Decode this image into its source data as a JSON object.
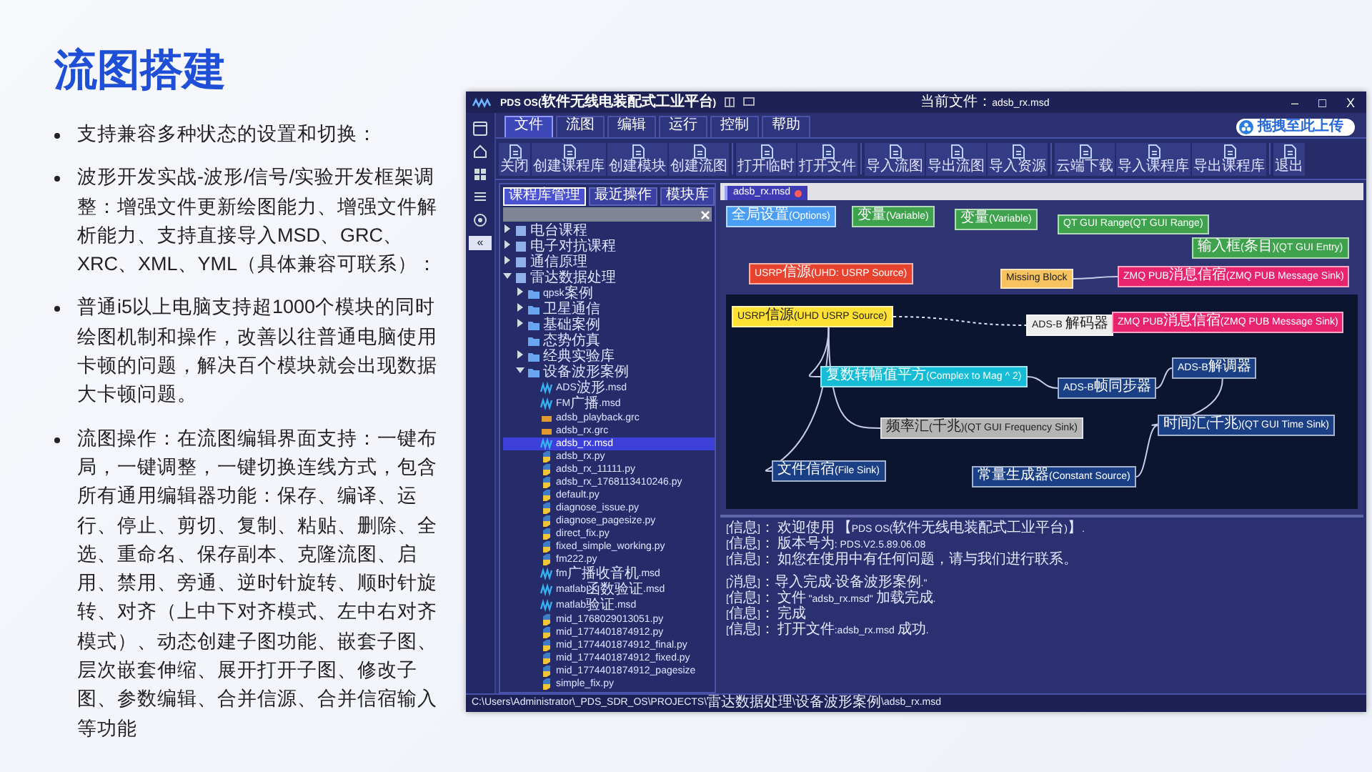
{
  "slide": {
    "title": "流图搭建",
    "bullets": [
      "支持兼容多种状态的设置和切换：",
      "波形开发实战-波形/信号/实验开发框架调整：增强文件更新绘图能力、增强文件解析能力、支持直接导入MSD、GRC、XRC、XML、YML（具体兼容可联系）：",
      "普通i5以上电脑支持超1000个模块的同时绘图机制和操作，改善以往普通电脑使用卡顿的问题，解决百个模块就会出现数据大卡顿问题。",
      "流图操作：在流图编辑界面支持：一键布局，一键调整，一键切换连线方式，包含所有通用编辑器功能：保存、编译、运行、停止、剪切、复制、粘贴、删除、全选、重命名、保存副本、克隆流图、启用、禁用、旁通、逆时针旋转、顺时针旋转、对齐（上中下对齐模式、左中右对齐模式）、动态创建子图功能、嵌套子图、层次嵌套伸缩、展开打开子图、修改子图、参数编辑、合并信源、合并信宿输入等功能"
    ]
  },
  "app": {
    "window": {
      "title": "PDS OS(软件无线电装配式工业平台)",
      "current_file": "当前文件：adsb_rx.msd",
      "controls": [
        "–",
        "□",
        "X"
      ]
    },
    "menu_tabs": [
      {
        "label": "文件",
        "selected": true
      },
      {
        "label": "流图",
        "selected": false
      },
      {
        "label": "编辑",
        "selected": false
      },
      {
        "label": "运行",
        "selected": false
      },
      {
        "label": "控制",
        "selected": false
      },
      {
        "label": "帮助",
        "selected": false
      }
    ],
    "upload_button": "拖拽至此上传",
    "toolbar": [
      [
        "关闭",
        "创建课程库",
        "创建模块",
        "创建流图"
      ],
      [
        "打开临时",
        "打开文件"
      ],
      [
        "导入流图",
        "导出流图",
        "导入资源"
      ],
      [
        "云端下载",
        "导入课程库",
        "导出课程库"
      ],
      [
        "退出"
      ]
    ],
    "sidebar": {
      "collapse_button": "«"
    },
    "tree_panel": {
      "tabs": [
        {
          "label": "课程库管理",
          "selected": true
        },
        {
          "label": "最近操作",
          "selected": false
        },
        {
          "label": "模块库",
          "selected": false
        }
      ],
      "items": [
        {
          "label": "电台课程",
          "kind": "group",
          "expanded": false,
          "selected": false
        },
        {
          "label": "电子对抗课程",
          "kind": "group",
          "expanded": false,
          "selected": false
        },
        {
          "label": "通信原理",
          "kind": "group",
          "expanded": false,
          "selected": false
        },
        {
          "label": "雷达数据处理",
          "kind": "group",
          "expanded": true,
          "selected": false,
          "children": [
            {
              "label": "qpsk案例",
              "kind": "folder",
              "expanded": false,
              "selected": false
            },
            {
              "label": "卫星通信",
              "kind": "folder",
              "expanded": false,
              "selected": false
            },
            {
              "label": "基础案例",
              "kind": "folder",
              "expanded": false,
              "selected": false
            },
            {
              "label": "态势仿真",
              "kind": "folder",
              "selected": false
            },
            {
              "label": "经典实验库",
              "kind": "folder",
              "expanded": false,
              "selected": false
            },
            {
              "label": "设备波形案例",
              "kind": "folder",
              "expanded": true,
              "selected": false,
              "children": [
                {
                  "label": "ADS波形.msd",
                  "kind": "msd",
                  "selected": false
                },
                {
                  "label": "FM广播.msd",
                  "kind": "msd",
                  "selected": false
                },
                {
                  "label": "adsb_playback.grc",
                  "kind": "grc",
                  "selected": false
                },
                {
                  "label": "adsb_rx.grc",
                  "kind": "grc",
                  "selected": false
                },
                {
                  "label": "adsb_rx.msd",
                  "kind": "msd",
                  "selected": true
                },
                {
                  "label": "adsb_rx.py",
                  "kind": "py",
                  "selected": false
                },
                {
                  "label": "adsb_rx_11111.py",
                  "kind": "py",
                  "selected": false
                },
                {
                  "label": "adsb_rx_1768113410246.py",
                  "kind": "py",
                  "selected": false
                },
                {
                  "label": "default.py",
                  "kind": "py",
                  "selected": false
                },
                {
                  "label": "diagnose_issue.py",
                  "kind": "py",
                  "selected": false
                },
                {
                  "label": "diagnose_pagesize.py",
                  "kind": "py",
                  "selected": false
                },
                {
                  "label": "direct_fix.py",
                  "kind": "py",
                  "selected": false
                },
                {
                  "label": "fixed_simple_working.py",
                  "kind": "py",
                  "selected": false
                },
                {
                  "label": "fm222.py",
                  "kind": "py",
                  "selected": false
                },
                {
                  "label": "fm广播收音机.msd",
                  "kind": "msd",
                  "selected": false
                },
                {
                  "label": "matlab函数验证.msd",
                  "kind": "msd",
                  "selected": false
                },
                {
                  "label": "matlab验证.msd",
                  "kind": "msd",
                  "selected": false
                },
                {
                  "label": "mid_1768029013051.py",
                  "kind": "py",
                  "selected": false
                },
                {
                  "label": "mid_1774401874912.py",
                  "kind": "py",
                  "selected": false
                },
                {
                  "label": "mid_1774401874912_final.py",
                  "kind": "py",
                  "selected": false
                },
                {
                  "label": "mid_1774401874912_fixed.py",
                  "kind": "py",
                  "selected": false
                },
                {
                  "label": "mid_1774401874912_pagesize",
                  "kind": "py",
                  "selected": false
                },
                {
                  "label": "simple_fix.py",
                  "kind": "py",
                  "selected": false
                }
              ]
            }
          ]
        }
      ]
    },
    "editor": {
      "tab": {
        "label": "adsb_rx.msd",
        "modified": true
      },
      "nodes": [
        {
          "label": "全局设置(Options)",
          "color": "#4a9ff5"
        },
        {
          "label": "变量(Variable)",
          "color": "#3fa34d"
        },
        {
          "label": "变量(Variable)",
          "color": "#3fa34d"
        },
        {
          "label": "QT GUI Range(QT GUI Range)",
          "color": "#3fa34d"
        },
        {
          "label": "输入框(条目)(QT GUI Entry)",
          "color": "#3fa34d"
        },
        {
          "label": "USRP信源(UHD: USRP Source)",
          "color": "#e8432f"
        },
        {
          "label": "Missing Block",
          "color": "#f7c35f"
        },
        {
          "label": "ZMQ PUB消息信宿(ZMQ PUB Message Sink)",
          "color": "#e8246e"
        },
        {
          "label": "USRP信源(UHD USRP Source)",
          "color": "#ffe135"
        },
        {
          "label": "ADS-B 解码器",
          "color": "#eeeeee"
        },
        {
          "label": "ZMQ PUB消息信宿(ZMQ PUB Message Sink)",
          "color": "#e8246e"
        },
        {
          "label": "复数转幅值平方(Complex to Mag ^ 2)",
          "color": "#15bcd6"
        },
        {
          "label": "ADS-B帧同步器",
          "color": "#1a3f85"
        },
        {
          "label": "ADS-B解调器",
          "color": "#1a3f85"
        },
        {
          "label": "频率汇(千兆)(QT GUI Frequency Sink)",
          "color": "#b5b5b5"
        },
        {
          "label": "文件信宿(File Sink)",
          "color": "#1a3f85"
        },
        {
          "label": "时间汇(千兆)(QT GUI Time Sink)",
          "color": "#1a3f85"
        },
        {
          "label": "常量生成器(Constant Source)",
          "color": "#1a3f85"
        }
      ]
    },
    "log": [
      [
        "[信息]： 欢迎使用 【PDS OS(软件无线电装配式工业平台)】.",
        "[信息]： 版本号为: PDS.V2.5.89.06.08",
        "[信息]： 如您在使用中有任何问题，请与我们进行联系。"
      ],
      [
        "[消息]：导入完成-设备波形案例.\"",
        "[信息]： 文件 \"adsb_rx.msd\" 加载完成.",
        "[信息]： 完成",
        "[信息]： 打开文件:adsb_rx.msd 成功."
      ]
    ],
    "status_bar": "C:\\Users\\Administrator\\_PDS_SDR_OS\\PROJECTS\\雷达数据处理\\设备波形案例\\adsb_rx.msd"
  }
}
